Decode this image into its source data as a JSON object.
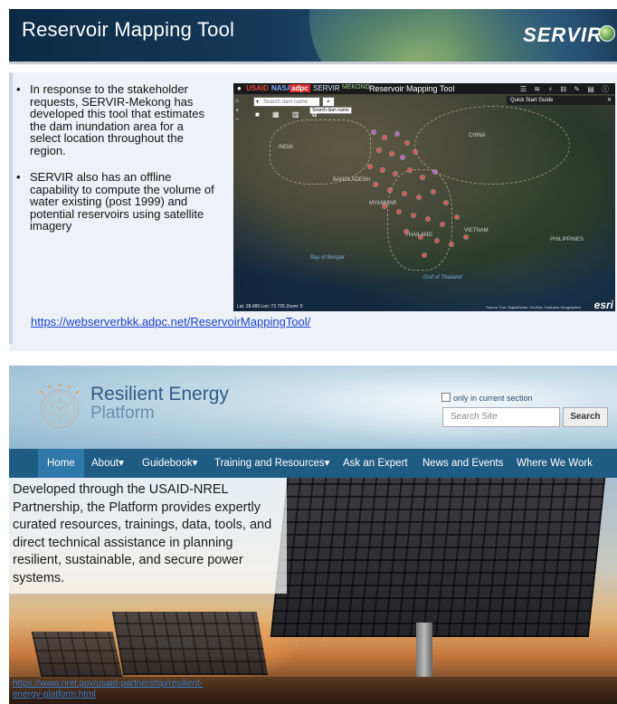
{
  "top_slide": {
    "title": "Reservoir Mapping Tool",
    "logo_text": "SERVIR",
    "bullets": [
      "In response to the stakeholder requests, SERVIR-Mekong has developed this tool that estimates the dam inundation area for a select location throughout the region.",
      "SERVIR also has an offline capability to compute the volume of water existing (post 1999) and potential reservoirs using satellite imagery"
    ],
    "link": "https://webserverbkk.adpc.net/ReservoirMappingTool/",
    "map": {
      "header_logos": [
        "USAID",
        "NASA",
        "adpc",
        "SERVIR",
        "MEKONG"
      ],
      "header_title": "Reservoir Mapping Tool",
      "search_placeholder": "Search dam name",
      "search_tooltip": "Search dam name",
      "quick_start": "Quick Start Guide",
      "labels": [
        "CHINA",
        "INDIA",
        "BANGLADESH",
        "MYANMAR",
        "THAILAND",
        "VIETNAM",
        "Bay of Bengal",
        "Gulf of Thailand",
        "PHILIPPINES"
      ],
      "footer_coords": "Lat: 28.489  Lon: 72.725  Zoom: 5",
      "credit": "Source: Esri, DigitalGlobe, GeoEye, Earthstar Geographics",
      "esri": "esri"
    }
  },
  "bottom_slide": {
    "brand_line1": "Resilient Energy",
    "brand_line2": "Platform",
    "section_checkbox": "only in current section",
    "search_placeholder": "Search Site",
    "search_button": "Search",
    "nav": [
      {
        "label": "Home",
        "active": true
      },
      {
        "label": "About"
      },
      {
        "label": "Guidebook"
      },
      {
        "label": "Training and Resources"
      },
      {
        "label": "Ask an Expert"
      },
      {
        "label": "News and Events"
      },
      {
        "label": "Where We Work"
      }
    ],
    "hero_text": "Developed through the USAID-NREL Partnership, the Platform provides expertly curated resources, trainings, data, tools, and direct technical assistance in planning resilient, sustainable, and secure power systems.",
    "hero_url": "https://www.nrel.gov/usaid-partnership/resilient-energy-platform.html"
  }
}
